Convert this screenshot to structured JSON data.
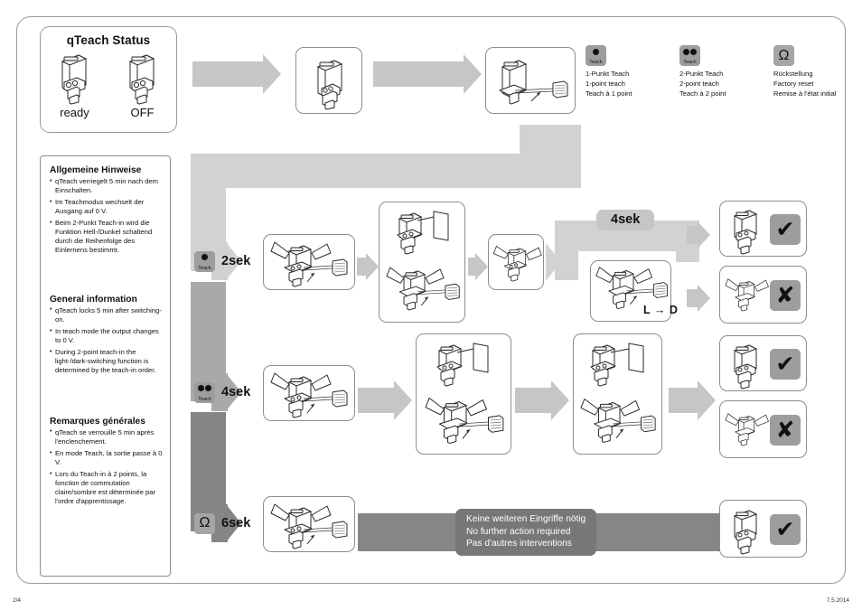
{
  "status_card": {
    "title": "qTeach Status",
    "cells": [
      {
        "icon": "sensor-ready-icon",
        "label": "ready"
      },
      {
        "icon": "sensor-off-icon",
        "label": "OFF"
      }
    ]
  },
  "info_panel": {
    "blocks": [
      {
        "heading": "Allgemeine Hinweise",
        "items": [
          "qTeach verriegelt 5 min nach dem Einschalten.",
          "Im Teachmodus wechselt der Ausgang auf 0 V.",
          "Beim 2-Punkt Teach-in wird die Funktion Hell-/Dunkel schaltend durch die Reihenfolge des Einlernens bestimmt."
        ]
      },
      {
        "heading": "General information",
        "items": [
          "qTeach locks 5 min after switching-on.",
          "In teach mode the output changes to 0 V.",
          "During 2-point teach-in the light-/dark-switching function is determined by the teach-in order."
        ]
      },
      {
        "heading": "Remarques générales",
        "items": [
          "qTeach se verrouille 5 min après l'enclenchement.",
          "En mode Teach, la sortie passe à 0 V.",
          "Lors du Teach-in à 2 points, la fonction de commutation claire/sombre est déterminée par l'ordre d'apprentissage."
        ]
      }
    ]
  },
  "legend": {
    "items": [
      {
        "icon": "teach-1-point-icon",
        "chip_text": "Teach",
        "lines": [
          "1-Punkt Teach",
          "1-point teach",
          "Teach à 1 point"
        ]
      },
      {
        "icon": "teach-2-point-icon",
        "chip_text": "Teach",
        "lines": [
          "2-Punkt Teach",
          "2-point teach",
          "Teach à 2 point"
        ]
      },
      {
        "icon": "factory-reset-icon",
        "chip_text": "",
        "lines": [
          "Rückstellung",
          "Factory reset",
          "Remise à l'état initial"
        ]
      }
    ]
  },
  "rows": [
    {
      "id": "row-2sek",
      "icon": "teach-1-point-icon",
      "chip_text": "Teach",
      "time": "2sek"
    },
    {
      "id": "row-4sek",
      "icon": "teach-2-point-icon",
      "chip_text": "Teach",
      "time": "4sek"
    },
    {
      "id": "row-6sek",
      "icon": "factory-reset-icon",
      "chip_text": "",
      "time": "6sek"
    }
  ],
  "row1": {
    "hold_label": "4sek",
    "ld_caption": "L → D",
    "results": [
      {
        "mark": "✔",
        "name": "check-mark"
      },
      {
        "mark": "✘",
        "name": "cross-mark"
      }
    ]
  },
  "row2": {
    "results": [
      {
        "mark": "✔",
        "name": "check-mark"
      },
      {
        "mark": "✘",
        "name": "cross-mark"
      }
    ]
  },
  "row3": {
    "banner_lines": [
      "Keine weiteren Eingriffe nötig",
      "No further action required",
      "Pas d'autres interventions"
    ],
    "result": {
      "mark": "✔",
      "name": "check-mark"
    }
  },
  "footer": {
    "page": "2/4",
    "date": "7.5.2014"
  },
  "colors": {
    "arrow_light": "#c6c6c6",
    "bar_light": "#d2d2d2",
    "bar_mid": "#a9a9a9",
    "bar_dark": "#858585",
    "banner": "#868686",
    "chip": "#9d9d9d"
  }
}
